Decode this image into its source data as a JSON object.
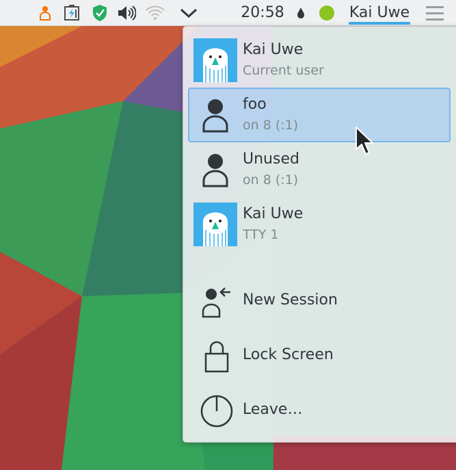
{
  "panel": {
    "clock": "20:58",
    "user_label": "Kai Uwe",
    "tray_icons": [
      "user-notification-icon",
      "battery-icon",
      "shield-icon",
      "volume-icon",
      "wifi-icon",
      "chevron-down-icon",
      "drop-icon",
      "status-dot-icon",
      "hamburger-menu-icon"
    ],
    "accent_color": "#3daee9"
  },
  "popup": {
    "users": [
      {
        "name": "Kai Uwe",
        "subtitle": "Current user",
        "avatar": "konqi-avatar",
        "highlighted": false
      },
      {
        "name": "foo",
        "subtitle": "on 8 (:1)",
        "avatar": "user-silhouette-icon",
        "highlighted": true
      },
      {
        "name": "Unused",
        "subtitle": "on 8 (:1)",
        "avatar": "user-silhouette-icon",
        "highlighted": false
      },
      {
        "name": "Kai Uwe",
        "subtitle": "TTY 1",
        "avatar": "konqi-avatar",
        "highlighted": false
      }
    ],
    "actions": [
      {
        "label": "New Session",
        "icon": "new-session-icon"
      },
      {
        "label": "Lock Screen",
        "icon": "lock-icon"
      },
      {
        "label": "Leave…",
        "icon": "power-icon"
      }
    ]
  }
}
